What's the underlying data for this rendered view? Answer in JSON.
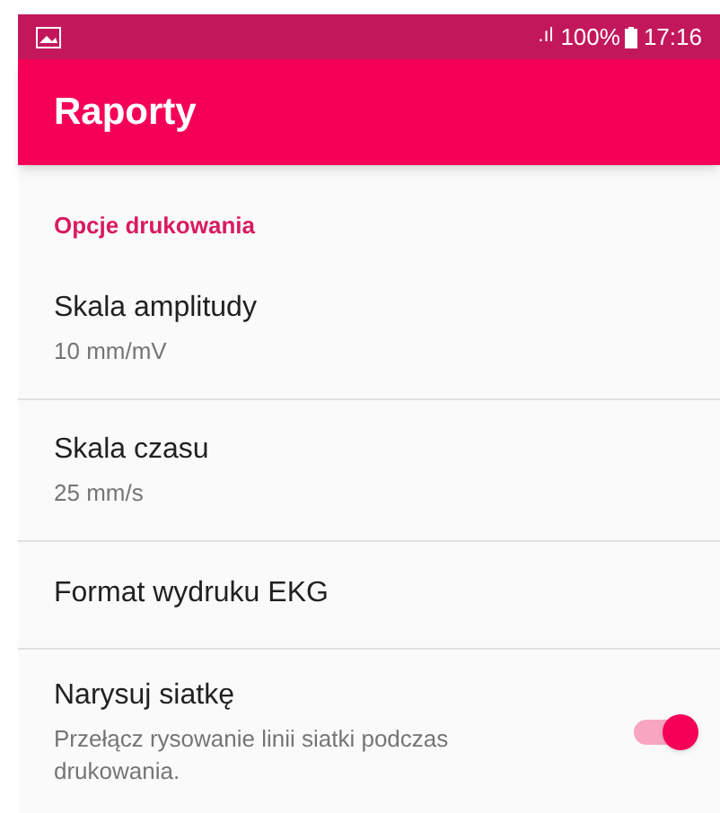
{
  "status_bar": {
    "signal": ".ıl",
    "battery": "100%",
    "time": "17:16"
  },
  "app_bar": {
    "title": "Raporty"
  },
  "section": {
    "title": "Opcje drukowania"
  },
  "items": [
    {
      "kind": "value",
      "title": "Skala amplitudy",
      "summary": "10 mm/mV"
    },
    {
      "kind": "value",
      "title": "Skala czasu",
      "summary": "25 mm/s"
    },
    {
      "kind": "plain",
      "title": "Format wydruku EKG"
    },
    {
      "kind": "switch",
      "title": "Narysuj siatkę",
      "summary": "Przełącz rysowanie linii siatki podczas drukowania.",
      "on": true
    }
  ]
}
